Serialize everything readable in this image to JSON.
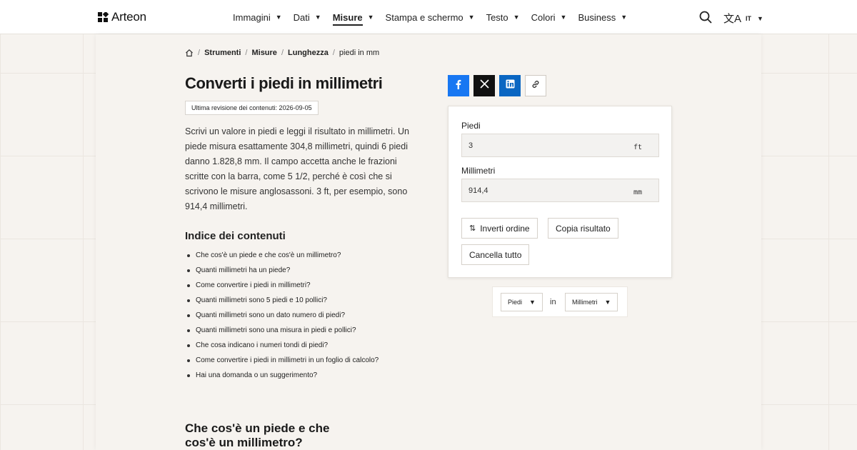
{
  "header": {
    "logo_text": "Arteon",
    "nav": [
      {
        "label": "Immagini",
        "active": false
      },
      {
        "label": "Dati",
        "active": false
      },
      {
        "label": "Misure",
        "active": true
      },
      {
        "label": "Stampa e schermo",
        "active": false
      },
      {
        "label": "Testo",
        "active": false
      },
      {
        "label": "Colori",
        "active": false
      },
      {
        "label": "Business",
        "active": false
      }
    ],
    "lang_glyph": "文A",
    "lang_code": "IT",
    "caret": "▼"
  },
  "breadcrumb": {
    "items": [
      "Strumenti",
      "Misure",
      "Lunghezza"
    ],
    "current": "piedi in mm",
    "separator": "/"
  },
  "page": {
    "title": "Converti i piedi in millimetri",
    "revision": "Ultima revisione dei contenuti: 2026-09-05",
    "intro": "Scrivi un valore in piedi e leggi il risultato in millimetri. Un piede misura esattamente 304,8 millimetri, quindi 6 piedi danno 1.828,8 mm. Il campo accetta anche le frazioni scritte con la barra, come 5 1/2, perché è così che si scrivono le misure anglosassoni. 3 ft, per esempio, sono 914,4 millimetri.",
    "toc_title": "Indice dei contenuti",
    "toc": [
      "Che cos'è un piede e che cos'è un millimetro?",
      "Quanti millimetri ha un piede?",
      "Come convertire i piedi in millimetri?",
      "Quanti millimetri sono 5 piedi e 10 pollici?",
      "Quanti millimetri sono un dato numero di piedi?",
      "Quanti millimetri sono una misura in piedi e pollici?",
      "Che cosa indicano i numeri tondi di piedi?",
      "Come convertire i piedi in millimetri in un foglio di calcolo?",
      "Hai una domanda o un suggerimento?"
    ],
    "section_title": "Che cos'è un piede e che cos'è un millimetro?"
  },
  "converter": {
    "field1": {
      "label": "Piedi",
      "value": "3",
      "unit": "ft"
    },
    "field2": {
      "label": "Millimetri",
      "value": "914,4",
      "unit": "mm"
    },
    "swap_glyph": "⇅",
    "swap_label": "Inverti ordine",
    "copy_label": "Copia risultato",
    "clear_label": "Cancella tutto"
  },
  "units": {
    "from": "Piedi",
    "connector": "in",
    "to": "Millimetri"
  },
  "colors": {
    "facebook": "#1877f2",
    "x": "#111111",
    "linkedin": "#0a66c2"
  }
}
